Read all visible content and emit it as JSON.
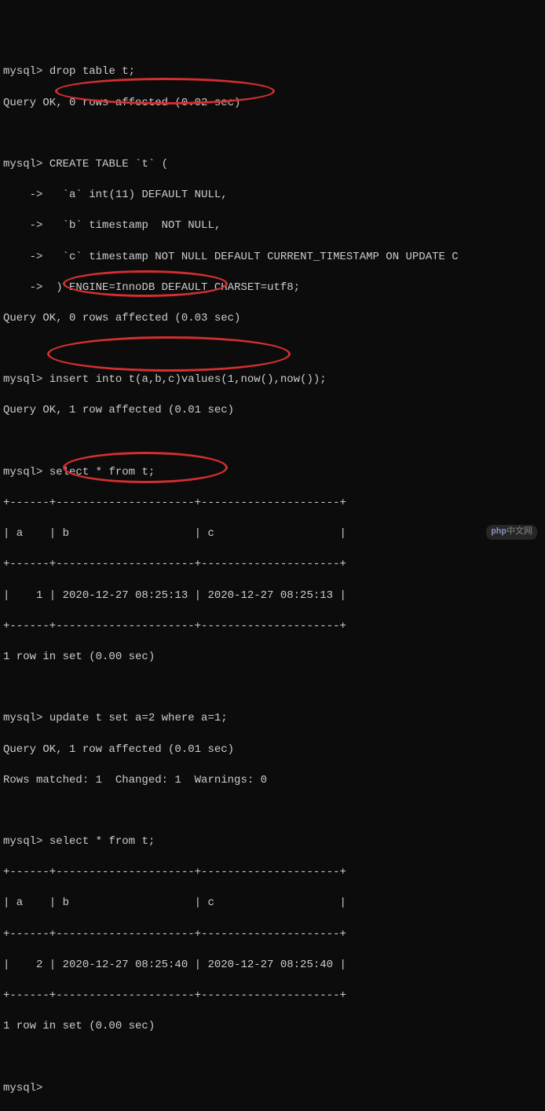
{
  "prompt": "mysql>",
  "cont": "    ->",
  "commands": {
    "drop": "drop table t;",
    "drop_result": "Query OK, 0 rows affected (0.02 sec)",
    "create": "CREATE TABLE `t` (",
    "create_a": "  `a` int(11) DEFAULT NULL,",
    "create_b": "  `b` timestamp  NOT NULL,",
    "create_c": "  `c` timestamp NOT NULL DEFAULT CURRENT_TIMESTAMP ON UPDATE C",
    "create_end": " ) ENGINE=InnoDB DEFAULT CHARSET=utf8;",
    "create_result": "Query OK, 0 rows affected (0.03 sec)",
    "insert": "insert into t(a,b,c)values(1,now(),now());",
    "insert_result": "Query OK, 1 row affected (0.01 sec)",
    "select": "select * from t;",
    "update": "update t set a=2 where a=1;",
    "update_result": "Query OK, 1 row affected (0.01 sec)",
    "update_matched": "Rows matched: 1  Changed: 1  Warnings: 0"
  },
  "table1": {
    "border": "+------+---------------------+---------------------+",
    "header": "| a    | b                   | c                   |",
    "row": "|    1 | 2020-12-27 08:25:13 | 2020-12-27 08:25:13 |",
    "footer": "1 row in set (0.00 sec)"
  },
  "table2": {
    "border": "+------+---------------------+---------------------+",
    "header": "| a    | b                   | c                   |",
    "row": "|    2 | 2020-12-27 08:25:40 | 2020-12-27 08:25:40 |",
    "footer": "1 row in set (0.00 sec)"
  },
  "watermark": {
    "php": "php",
    "text": "中文网"
  }
}
